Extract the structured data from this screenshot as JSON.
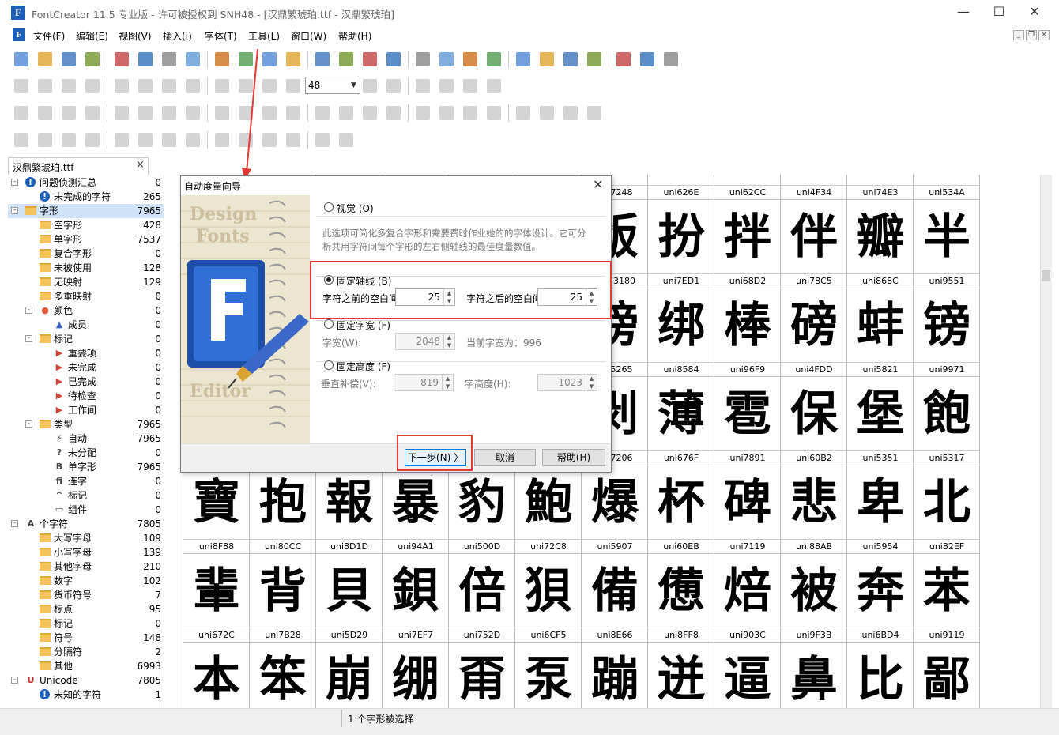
{
  "window": {
    "title": "FontCreator 11.5 专业版 - 许可被授权到 SNH48 - [汉鼎繁琥珀.ttf - 汉鼎繁琥珀]",
    "minimize": "—",
    "maximize": "☐",
    "close": "✕"
  },
  "menu": [
    "文件(F)",
    "编辑(E)",
    "视图(V)",
    "插入(I)",
    "字体(T)",
    "工具(L)",
    "窗口(W)",
    "帮助(H)"
  ],
  "toolbar": {
    "zoom_value": "48"
  },
  "tree": {
    "tab_label": "汉鼎繁琥珀.ttf",
    "tab_close": "×",
    "items": [
      {
        "label": "问题侦测汇总",
        "count": "0",
        "icon": "warning-icon"
      },
      {
        "label": "未完成的字符",
        "count": "265",
        "icon": "warning-icon"
      },
      {
        "label": "字形",
        "count": "7965",
        "icon": "folder-icon"
      },
      {
        "label": "空字形",
        "count": "428",
        "icon": "folder-icon"
      },
      {
        "label": "单字形",
        "count": "7537",
        "icon": "folder-icon"
      },
      {
        "label": "复合字形",
        "count": "0",
        "icon": "folder-icon"
      },
      {
        "label": "未被使用",
        "count": "128",
        "icon": "folder-icon"
      },
      {
        "label": "无映射",
        "count": "129",
        "icon": "folder-icon"
      },
      {
        "label": "多重映射",
        "count": "0",
        "icon": "folder-icon"
      },
      {
        "label": "颜色",
        "count": "0",
        "icon": "palette-icon"
      },
      {
        "label": "成员",
        "count": "0",
        "icon": "triangle-icon"
      },
      {
        "label": "标记",
        "count": "0",
        "icon": "folder-icon"
      },
      {
        "label": "重要项",
        "count": "0",
        "icon": "flag-icon"
      },
      {
        "label": "未完成",
        "count": "0",
        "icon": "flag-icon"
      },
      {
        "label": "已完成",
        "count": "0",
        "icon": "flag-icon"
      },
      {
        "label": "待检查",
        "count": "0",
        "icon": "flag-icon"
      },
      {
        "label": "工作间",
        "count": "0",
        "icon": "flag-icon"
      },
      {
        "label": "类型",
        "count": "7965",
        "icon": "folder-icon"
      },
      {
        "label": "自动",
        "count": "7965",
        "icon": "lightning-icon"
      },
      {
        "label": "未分配",
        "count": "0",
        "icon": "question-icon"
      },
      {
        "label": "单字形",
        "count": "7965",
        "icon": "b-icon"
      },
      {
        "label": "连字",
        "count": "0",
        "icon": "ligature-icon"
      },
      {
        "label": "标记",
        "count": "0",
        "icon": "caret-icon"
      },
      {
        "label": "组件",
        "count": "0",
        "icon": "component-icon"
      },
      {
        "label": "个字符",
        "count": "7805",
        "icon": "a-icon"
      },
      {
        "label": "大写字母",
        "count": "109",
        "icon": "folder-icon"
      },
      {
        "label": "小写字母",
        "count": "139",
        "icon": "folder-icon"
      },
      {
        "label": "其他字母",
        "count": "210",
        "icon": "folder-icon"
      },
      {
        "label": "数字",
        "count": "102",
        "icon": "folder-icon"
      },
      {
        "label": "货币符号",
        "count": "7",
        "icon": "folder-icon"
      },
      {
        "label": "标点",
        "count": "95",
        "icon": "folder-icon"
      },
      {
        "label": "标记",
        "count": "0",
        "icon": "folder-icon"
      },
      {
        "label": "符号",
        "count": "148",
        "icon": "folder-icon"
      },
      {
        "label": "分隔符",
        "count": "2",
        "icon": "folder-icon"
      },
      {
        "label": "其他",
        "count": "6993",
        "icon": "folder-icon"
      },
      {
        "label": "Unicode",
        "count": "7805",
        "icon": "unicode-icon"
      },
      {
        "label": "未知的字符",
        "count": "1",
        "icon": "warning-icon"
      }
    ]
  },
  "grid": {
    "rows": [
      {
        "names": [
          "",
          "",
          "",
          "",
          "",
          "",
          "uni7248",
          "uni626E",
          "uni62CC",
          "uni4F34",
          "uni74E3",
          "uni534A"
        ],
        "glyphs": [
          "",
          "",
          "",
          "",
          "",
          "",
          "",
          "",
          "",
          "",
          "",
          ""
        ]
      },
      {
        "names": [
          "",
          "",
          "",
          "",
          "",
          "",
          "uni53180",
          "uni7ED1",
          "uni68D2",
          "uni78C5",
          "uni868C",
          "uni9551"
        ],
        "glyphs": [
          "",
          "",
          "",
          "",
          "",
          "",
          "版",
          "扮",
          "拌",
          "伴",
          "瓣",
          "半"
        ]
      },
      {
        "names": [
          "",
          "",
          "",
          "",
          "",
          "",
          "uni5265",
          "uni8584",
          "uni96F9",
          "uni4FDD",
          "uni5821",
          "uni9971"
        ],
        "glyphs": [
          "",
          "",
          "",
          "",
          "",
          "",
          "谤",
          "绑",
          "棒",
          "磅",
          "蚌",
          "镑"
        ]
      },
      {
        "names": [
          "",
          "",
          "",
          "",
          "",
          "",
          "uni7206",
          "uni676F",
          "uni7891",
          "uni60B2",
          "uni5351",
          "uni5317"
        ],
        "glyphs": [
          "",
          "",
          "",
          "",
          "",
          "",
          "剥",
          "薄",
          "雹",
          "保",
          "堡",
          "飽"
        ]
      },
      {
        "names": [
          "uni8F88",
          "uni80CC",
          "uni8D1D",
          "uni94A1",
          "uni500D",
          "uni72C8",
          "uni5907",
          "uni60EB",
          "uni7119",
          "uni88AB",
          "uni5954",
          "uni82EF"
        ],
        "glyphs": [
          "寶",
          "抱",
          "報",
          "暴",
          "豹",
          "鮑",
          "爆",
          "杯",
          "碑",
          "悲",
          "卑",
          "北"
        ]
      },
      {
        "names": [
          "uni672C",
          "uni7B28",
          "uni5D29",
          "uni7EF7",
          "uni752D",
          "uni6CF5",
          "uni8E66",
          "uni8FF8",
          "uni903C",
          "uni9F3B",
          "uni6BD4",
          "uni9119"
        ],
        "glyphs": [
          "輩",
          "背",
          "貝",
          "鋇",
          "倍",
          "狽",
          "備",
          "憊",
          "焙",
          "被",
          "奔",
          "苯"
        ]
      },
      {
        "names": [
          "",
          "",
          "",
          "",
          "",
          "",
          "",
          "",
          "",
          "",
          "",
          ""
        ],
        "glyphs": [
          "本",
          "笨",
          "崩",
          "绷",
          "甭",
          "泵",
          "蹦",
          "迸",
          "逼",
          "鼻",
          "比",
          "鄙"
        ]
      }
    ]
  },
  "status": {
    "text": "1 个字形被选择"
  },
  "dialog": {
    "title": "自动度量向导",
    "close": "✕",
    "art_texts": [
      "Design",
      "Fonts",
      "Editor"
    ],
    "opt_visual": "视觉 (O)",
    "visual_desc_1": "此选项可简化多复合字形和需要费时作业她的的字体设计。它可分",
    "visual_desc_2": "析共用字符间每个字形的左右侧轴线的最佳度量数值。",
    "opt_fixed_axis": "固定轴线 (B)",
    "before_label": "字符之前的空白间",
    "before_value": "25",
    "after_label": "字符之后的空白间",
    "after_value": "25",
    "opt_fixed_width": "固定字宽 (F)",
    "width_label": "字宽(W):",
    "width_value": "2048",
    "current_width": "当前字宽为：996",
    "opt_fixed_height": "固定高度 (F)",
    "vcomp_label": "垂直补偿(V):",
    "vcomp_value": "819",
    "height_label": "字高度(H):",
    "height_value": "1023",
    "next": "下一步(N) 〉",
    "cancel": "取消",
    "help": "帮助(H)"
  }
}
